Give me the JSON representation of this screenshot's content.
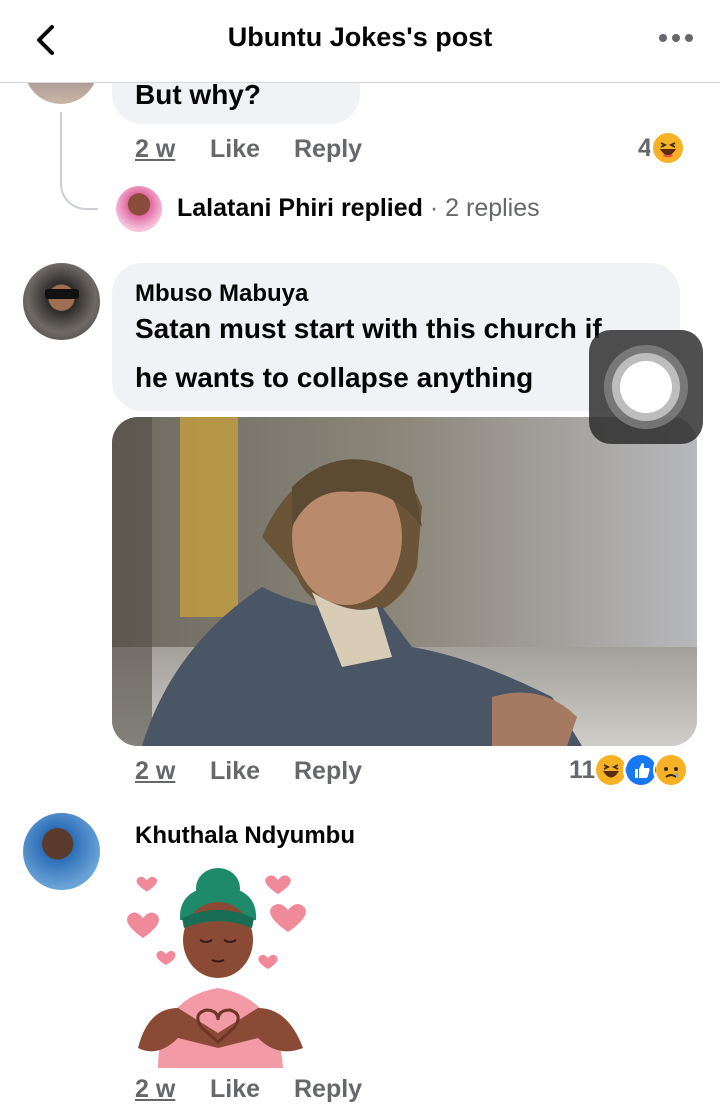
{
  "header": {
    "title": "Ubuntu Jokes's post",
    "back_icon": "chevron-left-icon",
    "more_icon": "more-horizontal-icon"
  },
  "comments": [
    {
      "text": "But why?",
      "time": "2 w",
      "like": "Like",
      "reply": "Reply",
      "reactions": {
        "count": "4",
        "icons": [
          "haha-icon"
        ]
      },
      "replies": {
        "name": "Lalatani Phiri",
        "action": "replied",
        "count": "· 2 replies"
      }
    },
    {
      "name": "Mbuso Mabuya",
      "text_line1": "Satan must start with this church if",
      "text_line2": "he wants to collapse anything",
      "time": "2 w",
      "like": "Like",
      "reply": "Reply",
      "reactions": {
        "count": "11",
        "icons": [
          "haha-icon",
          "like-icon",
          "sad-icon"
        ]
      }
    },
    {
      "name": "Khuthala Ndyumbu",
      "time": "2 w",
      "like": "Like",
      "reply": "Reply"
    }
  ],
  "colors": {
    "bubble": "#f0f2f5",
    "secondary_text": "#65676b",
    "like_blue": "#1877f2",
    "haha_yellow": "#f7b125"
  }
}
